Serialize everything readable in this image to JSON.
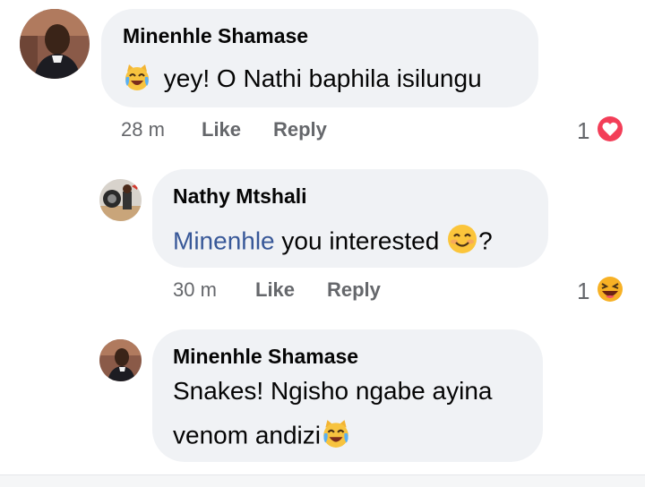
{
  "comments": [
    {
      "author": "Minenhle Shamase",
      "text": "yey! O Nathi baphila isilungu",
      "time": "28 m",
      "like_label": "Like",
      "reply_label": "Reply",
      "reaction_count": "1",
      "reaction": "love-reaction-icon"
    },
    {
      "author": "Nathy Mtshali",
      "mention": "Minenhle",
      "text": " you interested ",
      "text_end": "?",
      "time": "30 m",
      "like_label": "Like",
      "reply_label": "Reply",
      "reaction_count": "1",
      "reaction": "haha-reaction-icon"
    },
    {
      "author": "Minenhle Shamase",
      "text_line1": "Snakes! Ngisho ngabe ayina",
      "text_line2": "venom andizi"
    }
  ],
  "colors": {
    "bubble": "#f0f2f5",
    "meta": "#65676b",
    "mention": "#385898",
    "love": "#f33e58",
    "haha": "#f7b125"
  }
}
